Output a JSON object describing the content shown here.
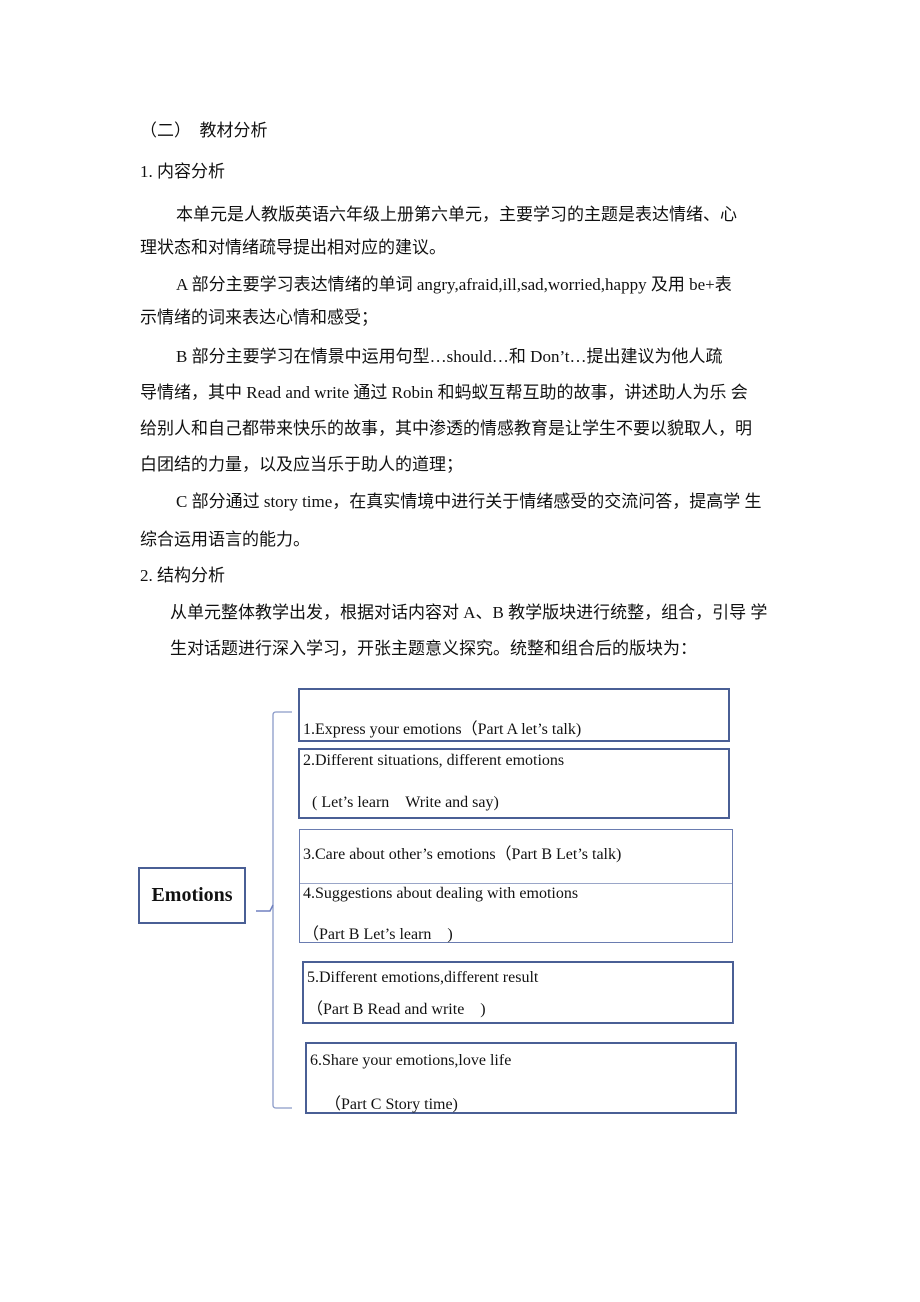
{
  "section_heading": "（二）　教材分析",
  "sub1": "1.  内容分析",
  "para1": [
    "本单元是人教版英语六年级上册第六单元，主要学习的主题是表达情绪、心",
    "理状态和对情绪疏导提出相对应的建议。"
  ],
  "paraA": [
    "A  部分主要学习表达情绪的单词  angry,afraid,ill,sad,worried,happy 及用  be+表",
    "示情绪的词来表达心情和感受；"
  ],
  "paraB": [
    "B  部分主要学习在情景中运用句型…should…和  Don’t…提出建议为他人疏",
    "导情绪，其中 Read and write 通过 Robin 和蚂蚁互帮互助的故事，讲述助人为乐 会",
    "给别人和自己都带来快乐的故事，其中渗透的情感教育是让学生不要以貌取人，明",
    "白团结的力量，以及应当乐于助人的道理；"
  ],
  "paraC": [
    "C 部分通过 story time，在真实情境中进行关于情绪感受的交流问答，提高学 生",
    "综合运用语言的能力。"
  ],
  "sub2": "2.  结构分析",
  "para2": [
    "从单元整体教学出发，根据对话内容对 A、B 教学版块进行统整，组合，引导 学",
    "生对话题进行深入学习，开张主题意义探究。统整和组合后的版块为："
  ],
  "diagram": {
    "root": "Emotions",
    "items": [
      {
        "line1": "1.Express your emotions（Part A let’s talk)"
      },
      {
        "line1": "2.Different situations, different emotions",
        "line2": "( Let’s learn　Write and say)"
      },
      {
        "line1": "3.Care about other’s emotions（Part B Let’s talk)"
      },
      {
        "line1": "4.Suggestions about dealing with emotions",
        "line2": "（Part B Let’s learn　)"
      },
      {
        "line1": "5.Different emotions,different result",
        "line2": "（Part B Read and write　)"
      },
      {
        "line1": "6.Share your emotions,love life",
        "line2": "（Part C Story time)"
      }
    ],
    "border_color": "#4a5f95"
  }
}
